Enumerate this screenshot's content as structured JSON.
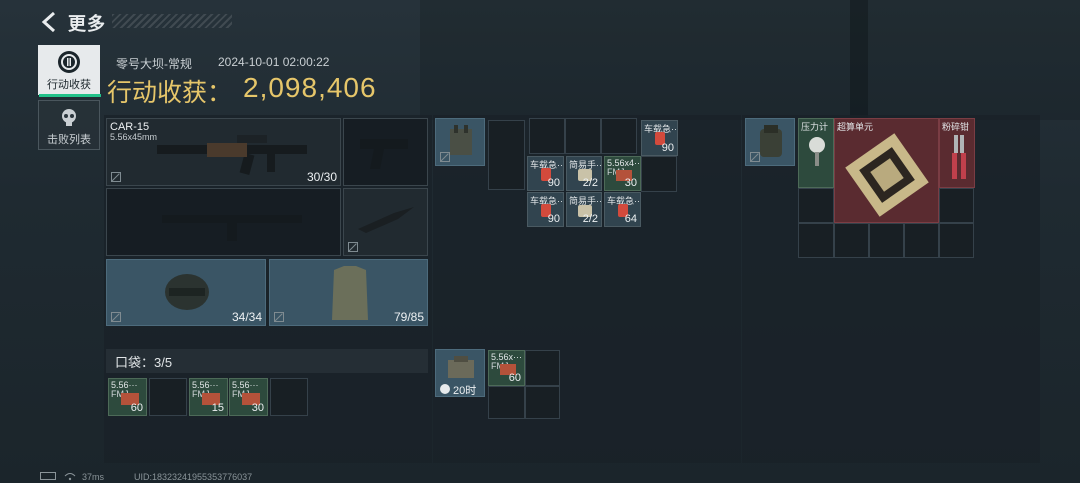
{
  "header": {
    "title": "更多"
  },
  "tabs": [
    {
      "label": "行动收获",
      "active": true,
      "icon": "loot-icon"
    },
    {
      "label": "击败列表",
      "active": false,
      "icon": "skull-icon"
    }
  ],
  "match": {
    "map": "零号大坝-常规",
    "datetime": "2024-10-01 02:00:22",
    "earnings_label": "行动收获：",
    "earnings_value": "2,098,406"
  },
  "loadout": {
    "primary": {
      "name": "CAR-15",
      "caliber": "5.56x45mm",
      "ammo": "30/30"
    },
    "helmet": {
      "durability": "34/34"
    },
    "armor": {
      "durability": "79/85"
    }
  },
  "pouch": {
    "title": "口袋：3/5",
    "items": [
      {
        "name": "5.56···",
        "sub": "FMJ",
        "count": "60"
      },
      {
        "name": "5.56···",
        "sub": "FMJ",
        "count": "15"
      },
      {
        "name": "5.56···",
        "sub": "FMJ",
        "count": "30"
      }
    ]
  },
  "rig": {
    "items": [
      {
        "name": "车载急···",
        "count": "90"
      },
      {
        "name": "车载急···",
        "count": "90"
      },
      {
        "name": "简易手···",
        "count": "2/2"
      },
      {
        "name": "5.56x4···",
        "sub": "FMJ",
        "count": "30"
      },
      {
        "name": "车载急···",
        "count": "90"
      },
      {
        "name": "简易手···",
        "count": "2/2"
      },
      {
        "name": "车载急···",
        "count": "64"
      }
    ]
  },
  "backpack_small": {
    "timer": "20时",
    "ammo": {
      "name": "5.56x···",
      "sub": "FMJ",
      "count": "60"
    }
  },
  "backpack": {
    "items": [
      {
        "name": "压力计"
      },
      {
        "name": "超算单元"
      },
      {
        "name": "粉碎钳"
      }
    ]
  },
  "status_bar": {
    "ping": "37ms",
    "uid": "UID:18323241955353776037"
  },
  "colors": {
    "accent_gold": "#e6c66a",
    "active_green": "#22c28a"
  }
}
